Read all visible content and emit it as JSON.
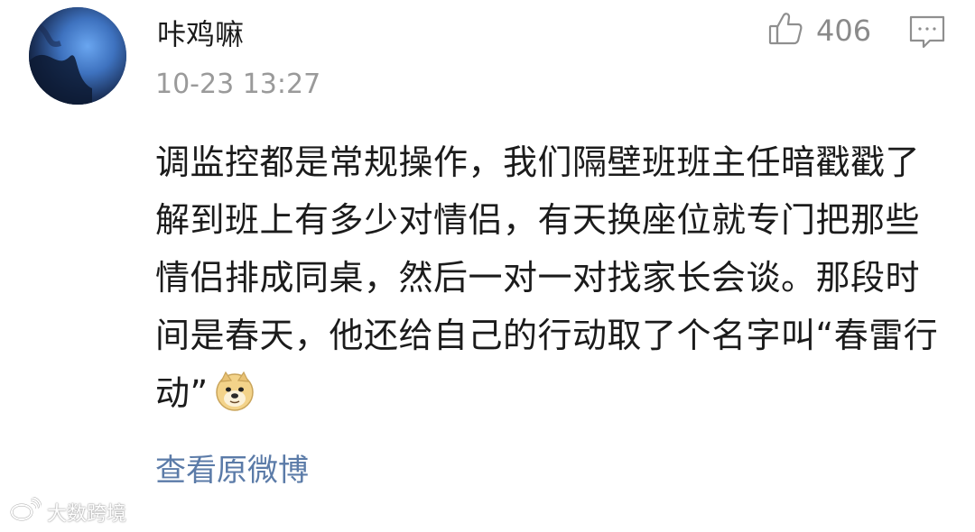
{
  "user": {
    "name": "咔鸡嘛",
    "timestamp": "10-23 13:27"
  },
  "actions": {
    "like_icon": "thumbs-up-icon",
    "like_count": "406",
    "comment_icon": "comment-icon"
  },
  "post": {
    "text": "调监控都是常规操作，我们隔壁班班主任暗戳戳了解到班上有多少对情侣，有天换座位就专门把那些情侣排成同桌，然后一对一对找家长会谈。那段时间是春天，他还给自己的行动取了个名字叫“春雷行动”",
    "emoji": "doge-emoji"
  },
  "link": {
    "view_original": "查看原微博"
  },
  "watermark": {
    "text": "大数跨境",
    "icon": "weibo-logo-icon"
  },
  "colors": {
    "link": "#5b7ba8",
    "meta": "#9a9a9a",
    "text": "#1b1b1b"
  }
}
